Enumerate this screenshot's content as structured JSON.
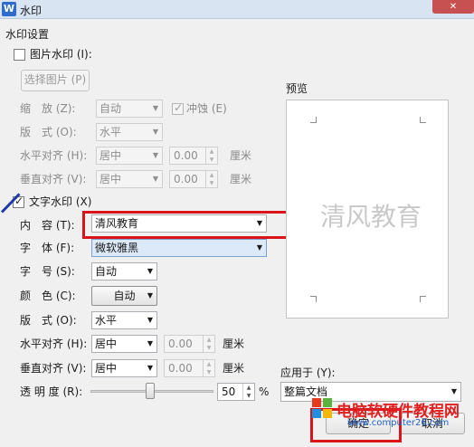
{
  "window": {
    "title": "水印",
    "app_icon_letter": "W",
    "close_glyph": "✕"
  },
  "settings_group_label": "水印设置",
  "picture_watermark": {
    "checkbox_label": "图片水印 (I):",
    "checked": false,
    "select_picture_button": "选择图片 (P)",
    "scale_label": "缩　放 (Z):",
    "scale_value": "自动",
    "washout_label": "冲蚀 (E)",
    "washout_checked": true,
    "layout_label": "版　式 (O):",
    "layout_value": "水平",
    "h_align_label": "水平对齐 (H):",
    "h_align_value": "居中",
    "h_offset_value": "0.00",
    "h_unit": "厘米",
    "v_align_label": "垂直对齐 (V):",
    "v_align_value": "居中",
    "v_offset_value": "0.00",
    "v_unit": "厘米"
  },
  "text_watermark": {
    "checkbox_label": "文字水印 (X)",
    "checked": true,
    "content_label": "内　容 (T):",
    "content_value": "清风教育",
    "font_label": "字　体 (F):",
    "font_value": "微软雅黑",
    "size_label": "字　号 (S):",
    "size_value": "自动",
    "color_label": "颜　色 (C):",
    "color_value": "自动",
    "layout_label": "版　式 (O):",
    "layout_value": "水平",
    "h_align_label": "水平对齐 (H):",
    "h_align_value": "居中",
    "h_offset_value": "0.00",
    "h_unit": "厘米",
    "v_align_label": "垂直对齐 (V):",
    "v_align_value": "居中",
    "v_offset_value": "0.00",
    "v_unit": "厘米",
    "transparency_label": "透 明 度 (R):",
    "transparency_value": "50",
    "transparency_unit": "%"
  },
  "preview": {
    "label": "预览",
    "watermark_text": "清风教育"
  },
  "apply_to": {
    "label": "应用于 (Y):",
    "value": "整篇文档"
  },
  "buttons": {
    "ok": "确定",
    "cancel": "取消"
  },
  "overlay": {
    "site_name": "电脑软硬件教程网",
    "site_url": "www.computer26.com"
  },
  "colors": {
    "highlight": "#d9141b",
    "arrow": "#1c3aa8",
    "font_select_bg": "#dbe9f8"
  }
}
